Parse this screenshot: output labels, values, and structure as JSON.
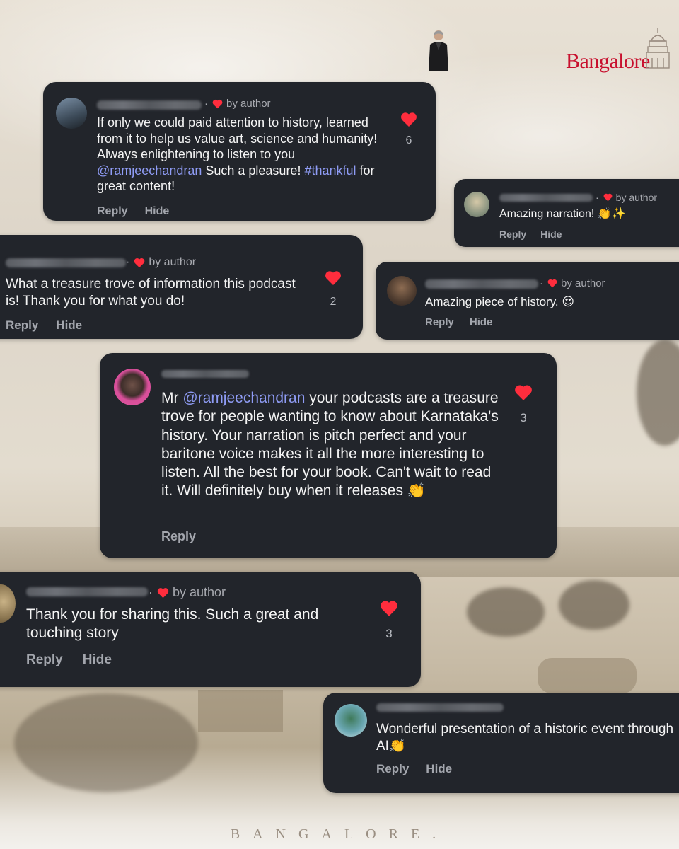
{
  "branding": {
    "logo_text": "Bangalore",
    "footer_text": "BANGALORE."
  },
  "colors": {
    "card": "#22252b",
    "heart": "#ff2d3d",
    "mention": "#8f9cf5",
    "logo": "#c8102e"
  },
  "comments": [
    {
      "author_badge": "by author",
      "text_a": "If only we could paid attention to history, learned from it to help us value art, science and humanity! Always enlightening to listen to you ",
      "mention": "@ramjeechandran",
      "text_b": " Such a pleasure! ",
      "hashtag": "#thankful",
      "text_c": " for great content!",
      "likes": "6",
      "reply": "Reply",
      "hide": "Hide"
    },
    {
      "author_badge": "by author",
      "text": "Amazing narration! 👏✨",
      "reply": "Reply",
      "hide": "Hide"
    },
    {
      "author_badge": "by author",
      "text": "What a treasure trove of information this podcast is! Thank you for what you do!",
      "likes": "2",
      "reply": "Reply",
      "hide": "Hide"
    },
    {
      "author_badge": "by author",
      "text": "Amazing piece of history. 😍",
      "reply": "Reply",
      "hide": "Hide"
    },
    {
      "text_a": "Mr ",
      "mention": "@ramjeechandran",
      "text_b": " your podcasts are a treasure trove for people wanting to know about Karnataka's history. Your narration is pitch perfect and your baritone voice makes it all the more interesting to listen. All the best for your book. Can't wait to read it. Will definitely buy when it releases 👏",
      "likes": "3",
      "reply": "Reply"
    },
    {
      "author_badge": "by author",
      "text": "Thank you for sharing this. Such a great and touching story",
      "likes": "3",
      "reply": "Reply",
      "hide": "Hide"
    },
    {
      "text": "Wonderful presentation of a historic event through AI👏",
      "reply": "Reply",
      "hide": "Hide"
    }
  ]
}
